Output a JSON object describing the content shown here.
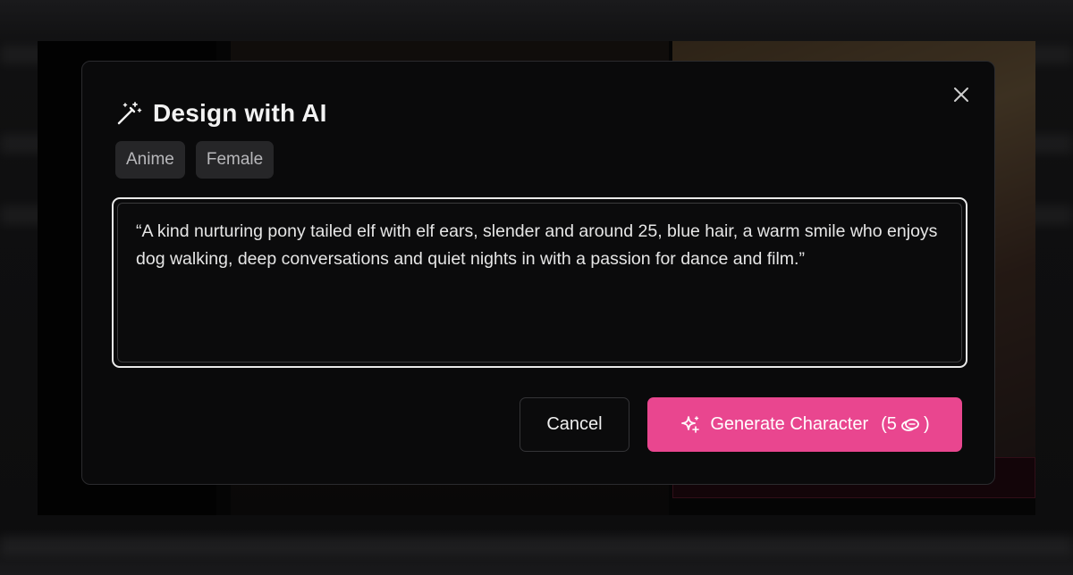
{
  "modal": {
    "title": "Design with AI",
    "title_icon": "magic-wand-icon",
    "close_icon": "close-icon",
    "tags": [
      {
        "label": "Anime"
      },
      {
        "label": "Female"
      }
    ],
    "prompt_text": "“A kind nurturing pony tailed elf with elf ears, slender and around 25, blue hair, a warm smile who enjoys dog walking, deep conversations and quiet nights in with a passion for dance and film.”",
    "cancel_label": "Cancel",
    "generate_label": "Generate Character",
    "generate_icon": "sparkles-icon",
    "cost_open": "(5",
    "cost_close": ")",
    "cost_icon": "coin-icon"
  },
  "colors": {
    "accent": "#e9468f",
    "modal_bg": "#0a0a0b",
    "tag_bg": "#262628",
    "text": "#f2f2f2"
  }
}
